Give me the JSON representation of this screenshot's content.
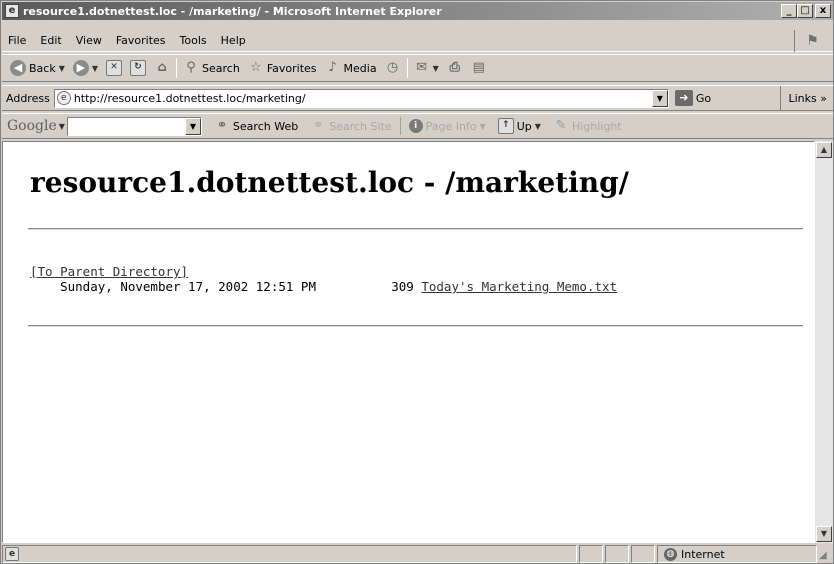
{
  "window": {
    "title": "resource1.dotnettest.loc - /marketing/ - Microsoft Internet Explorer",
    "buttons": {
      "minimize": "_",
      "maximize": "□",
      "close": "x"
    }
  },
  "menu": [
    "File",
    "Edit",
    "View",
    "Favorites",
    "Tools",
    "Help"
  ],
  "toolbar": {
    "back": "Back",
    "search": "Search",
    "favorites": "Favorites",
    "media": "Media"
  },
  "address": {
    "label": "Address",
    "url": "http://resource1.dotnettest.loc/marketing/",
    "go": "Go",
    "links": "Links"
  },
  "google": {
    "logo": "Google",
    "search_web": "Search Web",
    "search_site": "Search Site",
    "page_info": "Page Info",
    "up": "Up",
    "highlight": "Highlight"
  },
  "page": {
    "heading": "resource1.dotnettest.loc - /marketing/",
    "parent_link": "[To Parent Directory]",
    "entries": [
      {
        "date": "Sunday, November 17, 2002 12:51 PM",
        "size": "309",
        "name": "Today's Marketing Memo.txt"
      }
    ]
  },
  "status": {
    "zone": "Internet"
  },
  "icons": [
    "ie-page-icon",
    "back-icon",
    "forward-icon",
    "stop-icon",
    "refresh-icon",
    "home-icon",
    "search-icon",
    "favorites-icon",
    "media-icon",
    "history-icon",
    "mail-icon",
    "print-icon",
    "edit-icon",
    "go-icon",
    "binoculars-icon",
    "page-info-icon",
    "up-folder-icon",
    "highlight-icon",
    "globe-icon"
  ]
}
